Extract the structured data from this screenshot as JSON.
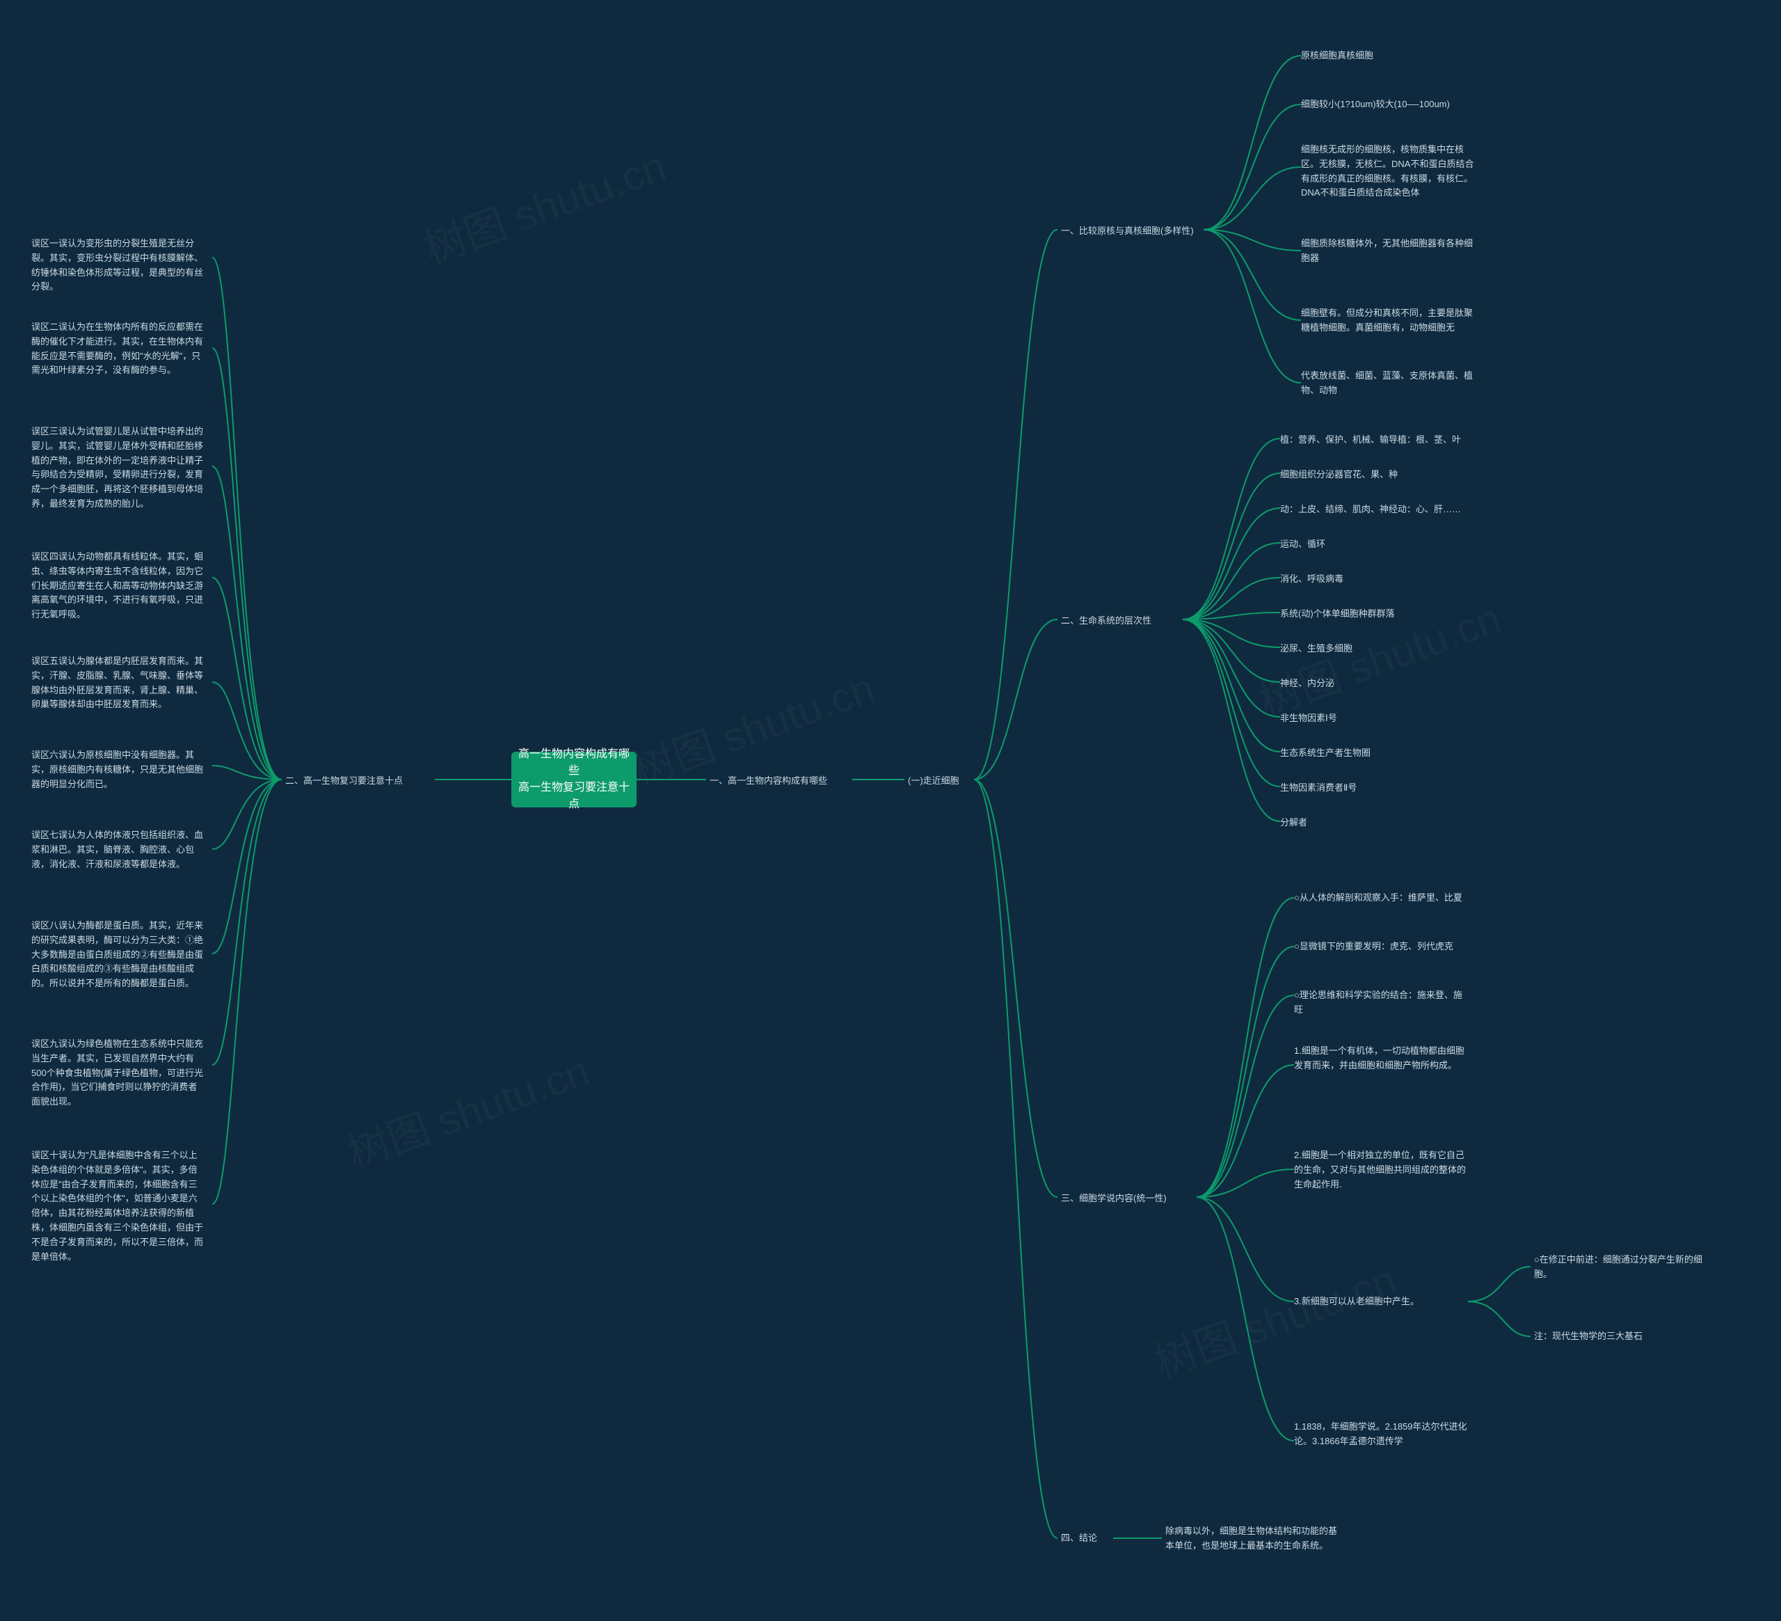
{
  "root": {
    "title_line1": "高一生物内容构成有哪些",
    "title_line2": "高一生物复习要注意十点"
  },
  "watermark": "树图 shutu.cn",
  "right": {
    "main1": "一、高一生物内容构成有哪些",
    "sub1": "(一)走近细胞",
    "r1": {
      "title": "一、比较原核与真核细胞(多样性)",
      "items": [
        "原核细胞真核细胞",
        "细胞较小(1?10um)较大(10—-100um)",
        "细胞核无成形的细胞核，核物质集中在核区。无核膜，无核仁。DNA不和蛋白质结合有成形的真正的细胞核。有核膜，有核仁。DNA不和蛋白质结合成染色体",
        "细胞质除核糖体外，无其他细胞器有各种细胞器",
        "细胞壁有。但成分和真核不同，主要是肽聚糖植物细胞。真菌细胞有，动物细胞无",
        "代表放线菌、细菌、蓝藻、支原体真菌、植物、动物"
      ]
    },
    "r2": {
      "title": "二、生命系统的层次性",
      "items": [
        "植：营养、保护、机械、输导植：根、茎、叶",
        "细胞组织分泌器官花、果、种",
        "动：上皮、结缔、肌肉、神经动：心、肝……",
        "运动、循环",
        "消化、呼吸病毒",
        "系统(动)个体单细胞种群群落",
        "泌尿、生殖多细胞",
        "神经、内分泌",
        "非生物因素Ⅰ号",
        "生态系统生产者生物圈",
        "生物因素消费者Ⅱ号",
        "分解者"
      ]
    },
    "r3": {
      "title": "三、细胞学说内容(统一性)",
      "items": [
        "○从人体的解剖和观察入手：维萨里、比夏",
        "○显微镜下的重要发明：虎克、列代虎克",
        "○理论思维和科学实验的结合：施来登、施旺",
        "1.细胞是一个有机体，一切动植物都由细胞发育而来，并由细胞和细胞产物所构成。",
        "2.细胞是一个相对独立的单位，既有它自己的生命，又对与其他细胞共同组成的整体的生命起作用.",
        "3.新细胞可以从老细胞中产生。",
        "1.1838，年细胞学说。2.1859年达尔代进化论。3.1866年孟德尔遗传学"
      ],
      "sub3_6": [
        "○在修正中前进：细胞通过分裂产生新的细胞。",
        "注：现代生物学的三大基石"
      ]
    },
    "r4": {
      "title": "四、结论",
      "content": "除病毒以外，细胞是生物体结构和功能的基本单位，也是地球上最基本的生命系统。"
    }
  },
  "left": {
    "main2": "二、高一生物复习要注意十点",
    "items": [
      "误区一误认为变形虫的分裂生殖是无丝分裂。其实，变形虫分裂过程中有核膜解体、纺锤体和染色体形成等过程，是典型的有丝分裂。",
      "误区二误认为在生物体内所有的反应都需在酶的催化下才能进行。其实，在生物体内有能反应是不需要酶的，例如\"水的光解\"，只需光和叶绿素分子，没有酶的参与。",
      "误区三误认为试管婴儿是从试管中培养出的婴儿。其实，试管婴儿是体外受精和胚胎移植的产物，即在体外的一定培养液中让精子与卵结合为受精卵，受精卵进行分裂，发育成一个多细胞胚，再将这个胚移植到母体培养，最终发育为成熟的胎儿。",
      "误区四误认为动物都具有线粒体。其实，蛔虫、绦虫等体内寄生虫不含线粒体，因为它们长期适应寄生在人和高等动物体内缺乏游离高氧气的环境中，不进行有氧呼吸，只进行无氧呼吸。",
      "误区五误认为腺体都是内胚层发育而来。其实，汗腺、皮脂腺、乳腺、气味腺、垂体等腺体均由外胚层发育而来，肾上腺、精巢、卵巢等腺体却由中胚层发育而来。",
      "误区六误认为原核细胞中没有细胞器。其实，原核细胞内有核糖体，只是无其他细胞器的明显分化而已。",
      "误区七误认为人体的体液只包括组织液、血浆和淋巴。其实，脑脊液、胸腔液、心包液，消化液、汗液和尿液等都是体液。",
      "误区八误认为酶都是蛋白质。其实，近年来的研究成果表明，酶可以分为三大类：①绝大多数酶是由蛋白质组成的②有些酶是由蛋白质和核酸组成的③有些酶是由核酸组成的。所以说并不是所有的酶都是蛋白质。",
      "误区九误认为绿色植物在生态系统中只能充当生产者。其实，已发现自然界中大约有500个种食虫植物(属于绿色植物，可进行光合作用)，当它们捕食时则以狰狞的消费者面貌出现。",
      "误区十误认为\"凡是体细胞中含有三个以上染色体组的个体就是多倍体\"。其实，多倍体应是\"由合子发育而来的，体细胞含有三个以上染色体组的个体\"，如普通小麦是六倍体，由其花粉经离体培养法获得的新植株，体细胞内虽含有三个染色体组，但由于不是合子发育而来的，所以不是三倍体，而是单倍体。"
    ]
  }
}
